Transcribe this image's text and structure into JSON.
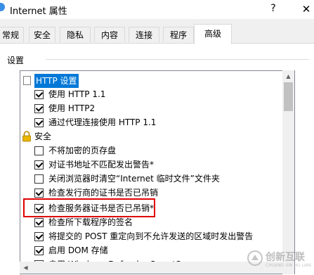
{
  "window": {
    "title": "Internet 属性",
    "help": "?",
    "close": "✕"
  },
  "tabs": [
    "常规",
    "安全",
    "隐私",
    "内容",
    "连接",
    "程序",
    "高级"
  ],
  "active_tab": "高级",
  "settings_group": {
    "label": "设置"
  },
  "items": [
    {
      "type": "folder",
      "text": "HTTP 设置",
      "selected": true
    },
    {
      "type": "checkbox",
      "text": "使用 HTTP 1.1",
      "checked": true
    },
    {
      "type": "checkbox",
      "text": "使用 HTTP2",
      "checked": true
    },
    {
      "type": "checkbox",
      "text": "通过代理连接使用 HTTP 1.1",
      "checked": true
    },
    {
      "type": "lock",
      "text": "安全"
    },
    {
      "type": "checkbox",
      "text": "不将加密的页存盘",
      "checked": false
    },
    {
      "type": "checkbox",
      "text": "对证书地址不匹配发出警告*",
      "checked": true
    },
    {
      "type": "checkbox",
      "text": "关闭浏览器时清空“Internet 临时文件”文件夹",
      "checked": false
    },
    {
      "type": "checkbox",
      "text": "检查发行商的证书是否已吊销",
      "checked": true
    },
    {
      "type": "checkbox",
      "text": "检查服务器证书是否已吊销*",
      "checked": true
    },
    {
      "type": "checkbox",
      "text": "检查所下载程序的签名",
      "checked": true
    },
    {
      "type": "checkbox",
      "text": "将提交的 POST 重定向到不允许发送的区域时发出警告",
      "checked": true
    },
    {
      "type": "checkbox",
      "text": "启用 DOM 存储",
      "checked": true
    },
    {
      "type": "checkbox",
      "text": "启用 Windows Defender SmartScreen",
      "checked": true
    }
  ],
  "watermark": {
    "text": "创新互联",
    "sub": "CHUANG XIN HU LIAN"
  }
}
